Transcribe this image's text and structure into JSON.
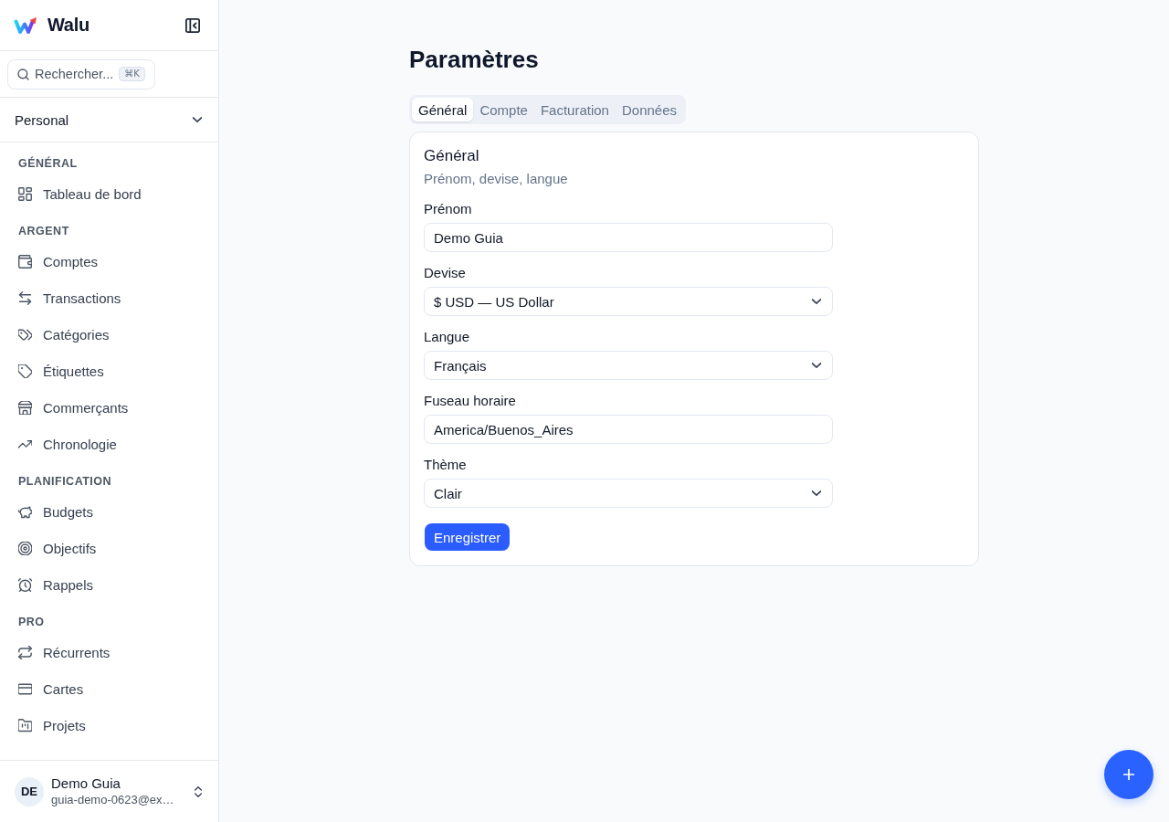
{
  "sidebar": {
    "brand": {
      "name": "Walu"
    },
    "search": {
      "label": "Rechercher...",
      "shortcut": "⌘K"
    },
    "workspace": {
      "label": "Personal"
    },
    "sections": [
      {
        "label": "GÉNÉRAL",
        "items": [
          {
            "label": "Tableau de bord",
            "selected": false
          }
        ]
      },
      {
        "label": "ARGENT",
        "items": [
          {
            "label": "Comptes",
            "selected": false
          },
          {
            "label": "Transactions",
            "selected": false
          },
          {
            "label": "Catégories",
            "selected": false
          },
          {
            "label": "Étiquettes",
            "selected": false
          },
          {
            "label": "Commerçants",
            "selected": false
          },
          {
            "label": "Chronologie",
            "selected": false
          }
        ]
      },
      {
        "label": "PLANIFICATION",
        "items": [
          {
            "label": "Budgets",
            "selected": false
          },
          {
            "label": "Objectifs",
            "selected": false
          },
          {
            "label": "Rappels",
            "selected": false
          }
        ]
      },
      {
        "label": "PRO",
        "items": [
          {
            "label": "Récurrents",
            "selected": false
          },
          {
            "label": "Cartes",
            "selected": false
          },
          {
            "label": "Projets",
            "selected": false
          }
        ]
      }
    ],
    "user": {
      "initials": "DE",
      "name": "Demo Guia",
      "email": "guia-demo-0623@ex…"
    }
  },
  "page": {
    "title": "Paramètres",
    "tabs": [
      {
        "label": "Général",
        "selected": true
      },
      {
        "label": "Compte",
        "selected": false
      },
      {
        "label": "Facturation",
        "selected": false
      },
      {
        "label": "Données",
        "selected": false
      }
    ],
    "card": {
      "title": "Général",
      "subtitle": "Prénom, devise, langue",
      "fields": [
        {
          "kind": "text",
          "label": "Prénom",
          "value": "Demo Guia"
        },
        {
          "kind": "select",
          "label": "Devise",
          "value": "$ USD — US Dollar"
        },
        {
          "kind": "select",
          "label": "Langue",
          "value": "Français"
        },
        {
          "kind": "text",
          "label": "Fuseau horaire",
          "value": "America/Buenos_Aires"
        },
        {
          "kind": "select",
          "label": "Thème",
          "value": "Clair"
        }
      ],
      "submit": "Enregistrer"
    }
  }
}
